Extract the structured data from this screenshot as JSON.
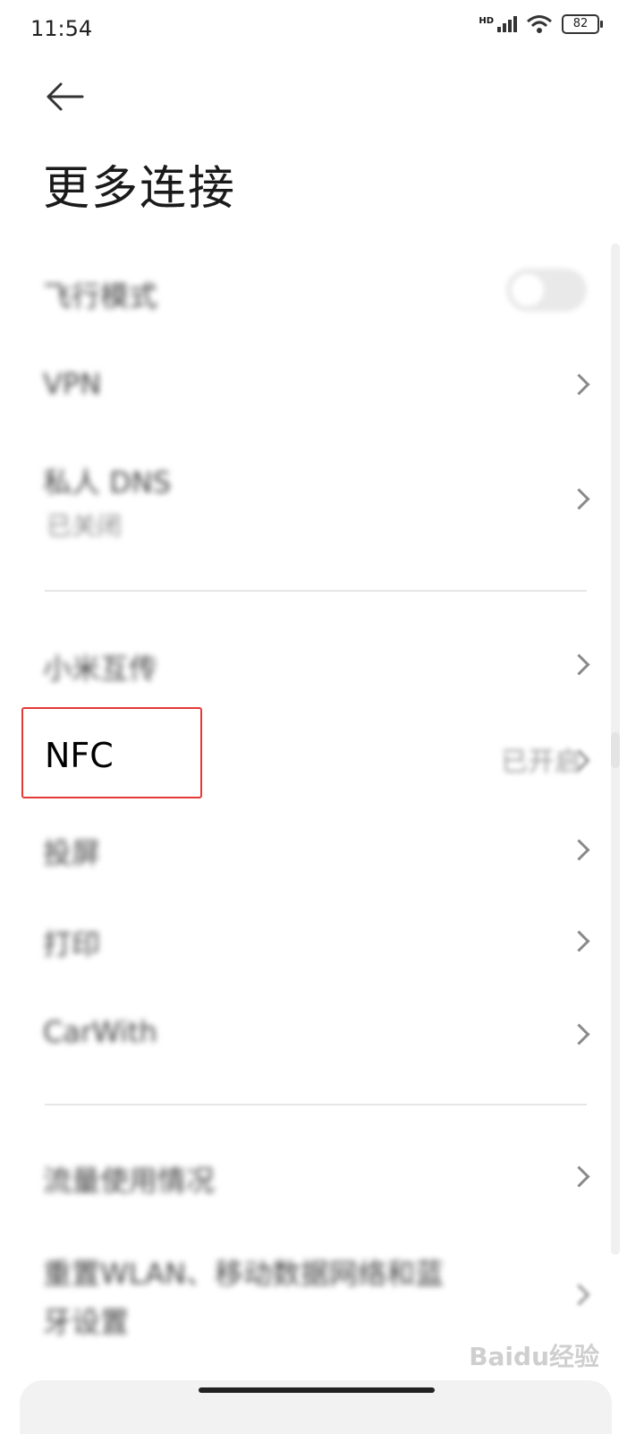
{
  "status_bar": {
    "time": "11:54",
    "network": "HD",
    "battery": "82"
  },
  "header": {
    "title": "更多连接"
  },
  "items": {
    "airplane": {
      "label": "飞行模式",
      "toggle_on": false
    },
    "vpn": {
      "label": "VPN"
    },
    "private_dns": {
      "label": "私人 DNS",
      "sub": "已关闭"
    },
    "xiaomi_share": {
      "label": "小米互传"
    },
    "nfc": {
      "label": "NFC",
      "status": "已开启"
    },
    "cast": {
      "label": "投屏"
    },
    "print": {
      "label": "打印"
    },
    "carwith": {
      "label": "CarWith"
    },
    "data_usage": {
      "label": "流量使用情况"
    },
    "reset": {
      "label": "重置WLAN、移动数据网络和蓝",
      "label2": "牙设置"
    }
  },
  "watermark": {
    "text": "Baidu经验"
  }
}
